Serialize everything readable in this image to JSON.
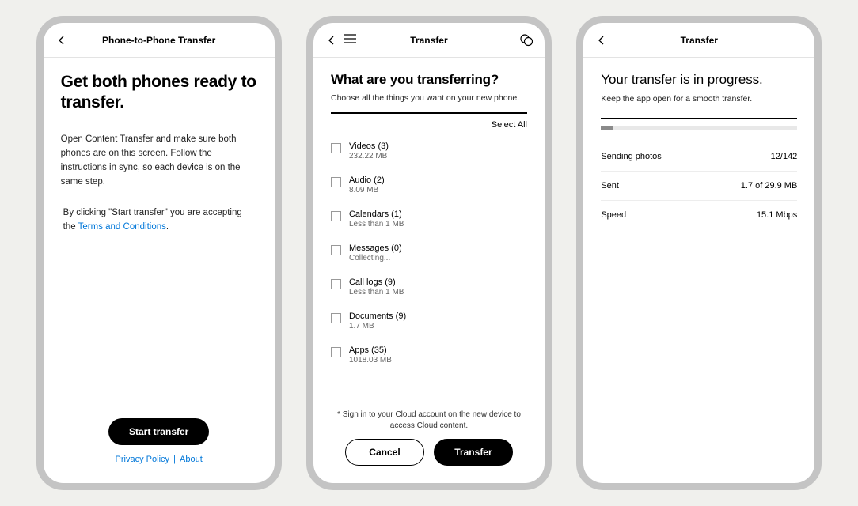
{
  "screen1": {
    "header_title": "Phone-to-Phone Transfer",
    "title": "Get both phones ready to transfer.",
    "paragraph": "Open Content Transfer and make sure both phones are on this screen. Follow the instructions in sync, so each device is on the same step.",
    "accept_prefix": "By clicking \"Start transfer\" you are accepting the ",
    "accept_link": "Terms and Conditions",
    "accept_suffix": ".",
    "start_button": "Start transfer",
    "privacy": "Privacy Policy",
    "sep": " | ",
    "about": "About"
  },
  "screen2": {
    "header_title": "Transfer",
    "title": "What are you transferring?",
    "sub": "Choose all the things you want on your new phone.",
    "select_all": "Select All",
    "items": [
      {
        "label": "Videos (3)",
        "detail": "232.22 MB"
      },
      {
        "label": "Audio (2)",
        "detail": "8.09 MB"
      },
      {
        "label": "Calendars (1)",
        "detail": "Less than 1 MB"
      },
      {
        "label": "Messages (0)",
        "detail": "Collecting..."
      },
      {
        "label": "Call logs (9)",
        "detail": "Less than 1 MB"
      },
      {
        "label": "Documents (9)",
        "detail": "1.7 MB"
      },
      {
        "label": "Apps (35)",
        "detail": "1018.03 MB"
      }
    ],
    "cloud_note": "* Sign in to your Cloud account on the new device to access Cloud content.",
    "cancel": "Cancel",
    "transfer": "Transfer"
  },
  "screen3": {
    "header_title": "Transfer",
    "title": "Your transfer is in progress.",
    "sub": "Keep the app open for a smooth transfer.",
    "rows": [
      {
        "label": "Sending photos",
        "value": "12/142"
      },
      {
        "label": "Sent",
        "value": "1.7 of 29.9 MB"
      },
      {
        "label": "Speed",
        "value": "15.1 Mbps"
      }
    ]
  }
}
